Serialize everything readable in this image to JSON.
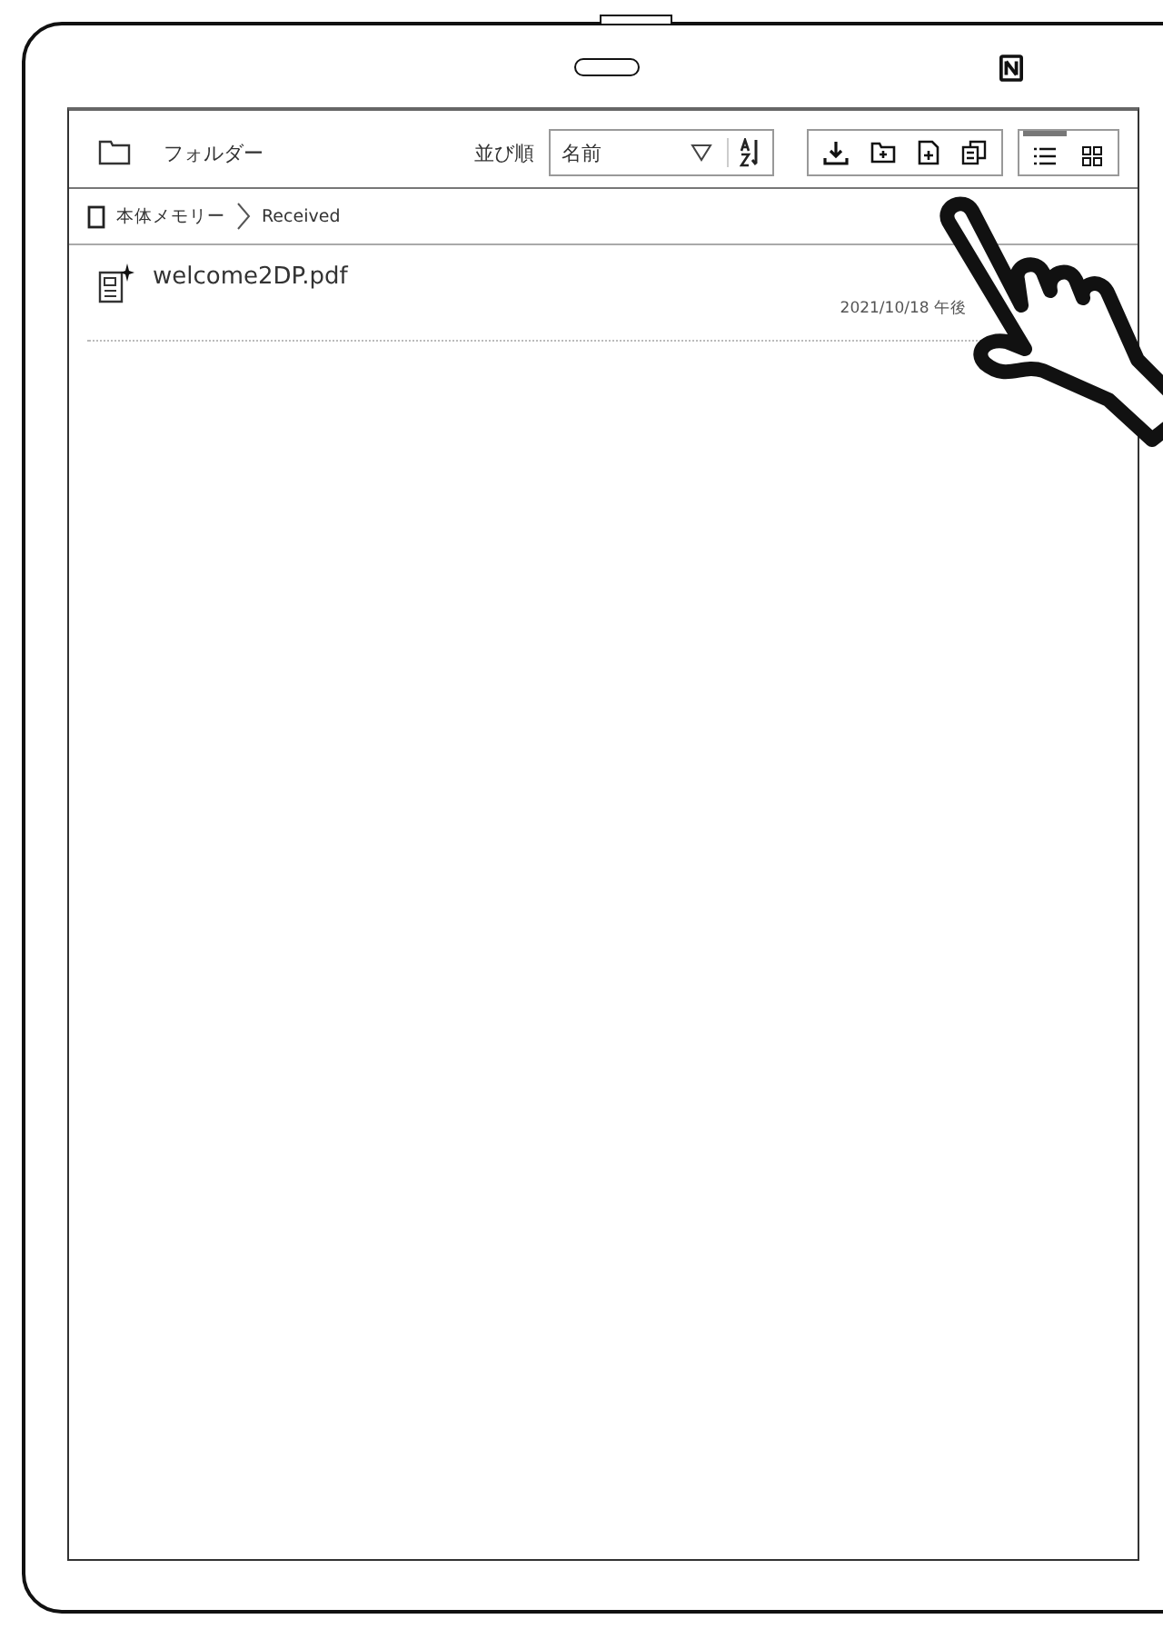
{
  "toolbar": {
    "folder_label": "フォルダー",
    "sort_label": "並び順",
    "sort_value": "名前",
    "view_modes": [
      {
        "kind": "list",
        "selected": true
      },
      {
        "kind": "grid",
        "selected": false
      }
    ]
  },
  "breadcrumb": [
    "本体メモリー",
    "Received"
  ],
  "files": [
    {
      "name": "welcome2DP.pdf",
      "date": "2021/10/18 午後"
    }
  ]
}
